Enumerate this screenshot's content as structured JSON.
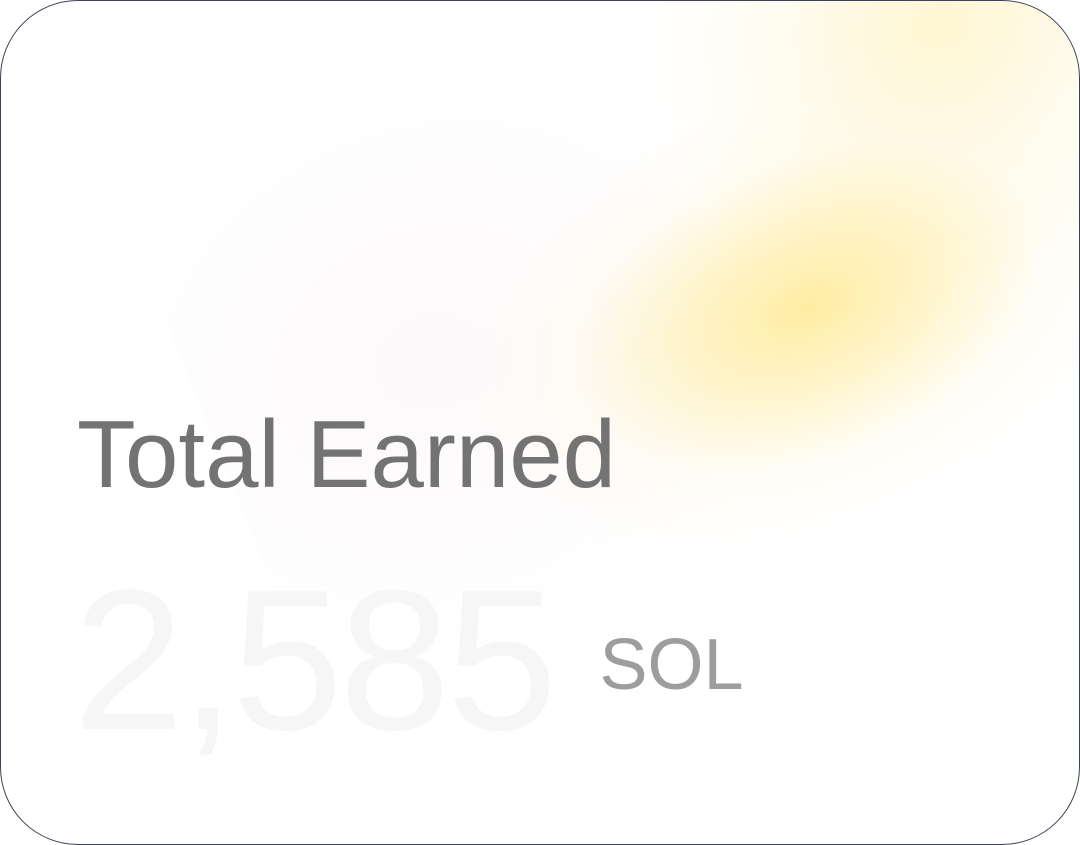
{
  "card": {
    "title": "Total Earned",
    "amount": "2,585",
    "currency": "SOL"
  },
  "colors": {
    "title": "#737373",
    "amount": "#f6f6f6",
    "currency": "#9d9d9d",
    "glow": "#ffe88c",
    "border": "#3c4254"
  }
}
